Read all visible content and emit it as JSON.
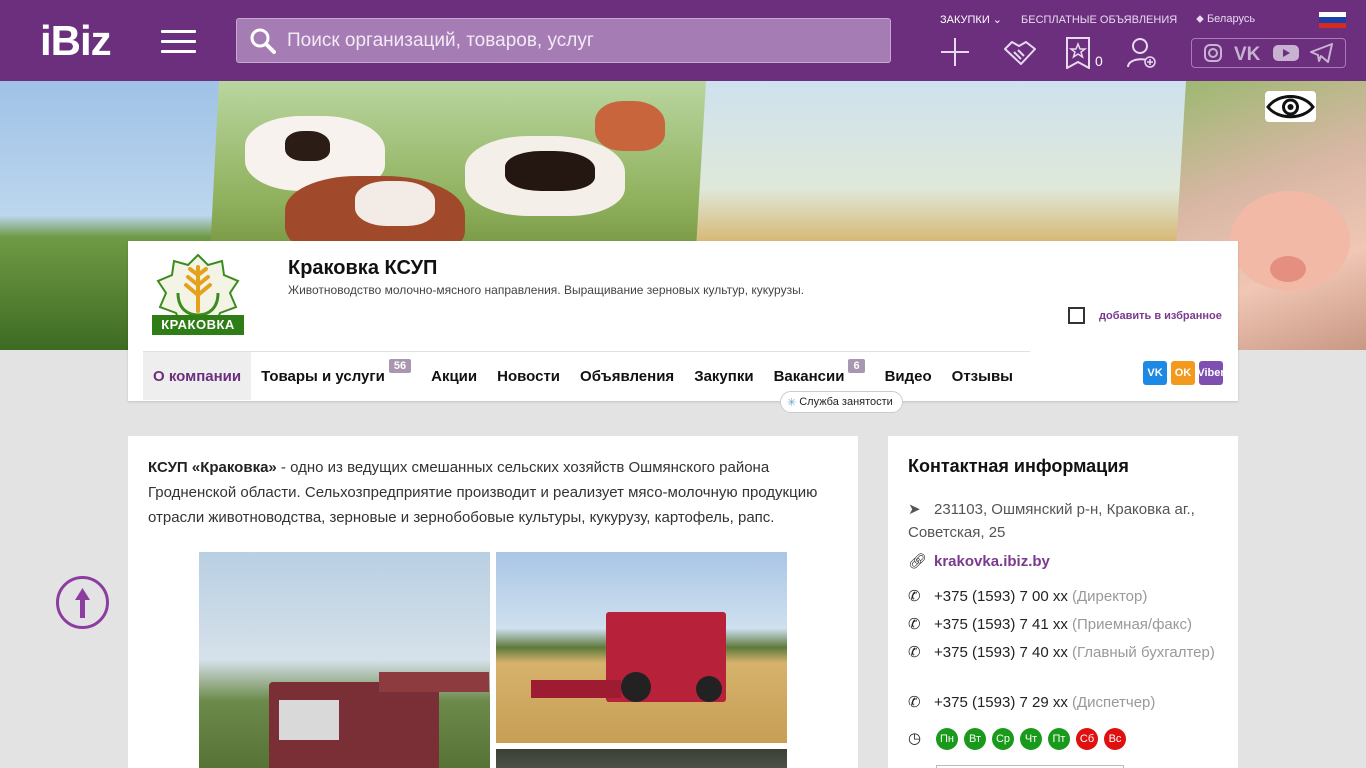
{
  "header": {
    "logo": "iBiz",
    "search_placeholder": "Поиск организаций, товаров, услуг",
    "links": [
      "ЗАКУПКИ",
      "БЕСПЛАТНЫЕ ОБЪЯВЛЕНИЯ",
      "Беларусь"
    ],
    "favorites_count": "0",
    "colors": {
      "brand": "#6b2f7e",
      "search_bg": "#a57cb3"
    },
    "icons": [
      "menu-icon",
      "search-icon",
      "plus-icon",
      "handshake-icon",
      "star-icon",
      "add-user-icon",
      "instagram-icon",
      "vk-icon",
      "youtube-icon",
      "telegram-icon",
      "location-icon"
    ]
  },
  "company": {
    "logo_text": "КРАКОВКА",
    "name": "Краковка КСУП",
    "description": "Животноводство молочно-мясного направления. Выращивание зерновых культур, кукурузы.",
    "favorite_label": "добавить в избранное",
    "tabs": [
      {
        "label": "О компании",
        "badge": ""
      },
      {
        "label": "Товары и услуги",
        "badge": "56"
      },
      {
        "label": "Акции",
        "badge": ""
      },
      {
        "label": "Новости",
        "badge": ""
      },
      {
        "label": "Объявления",
        "badge": ""
      },
      {
        "label": "Закупки",
        "badge": ""
      },
      {
        "label": "Вакансии",
        "badge": "6"
      },
      {
        "label": "Видео",
        "badge": ""
      },
      {
        "label": "Отзывы",
        "badge": ""
      }
    ],
    "vacancy_tag": "Служба занятости",
    "share": [
      "VK",
      "OK",
      "Viber"
    ]
  },
  "main": {
    "intro_bold": "КСУП «Краковка»",
    "intro_text": " - одно из ведущих смешанных сельских хозяйств Ошмянского района Гродненской области. Сельхозпредприятие производит и реализует мясо-молочную продукцию отрасли животноводства, зерновые и зернобобовые культуры, кукурузу, картофель, рапс."
  },
  "contacts": {
    "title": "Контактная информация",
    "address": "231103, Ошмянский р-н, Краковка аг., Советская, 25",
    "site": "krakovka.ibiz.by",
    "phones": [
      {
        "number": "+375 (1593) 7 00 xx",
        "note": "(Директор)"
      },
      {
        "number": "+375 (1593) 7 41 xx",
        "note": "(Приемная/факс)"
      },
      {
        "number": "+375 (1593) 7 40 xx",
        "note": "(Главный бухгалтер)"
      },
      {
        "number": "+375 (1593) 7 29 xx",
        "note": "(Диспетчер)"
      }
    ],
    "days": [
      {
        "label": "Пн",
        "color": "#1a9a1a"
      },
      {
        "label": "Вт",
        "color": "#1a9a1a"
      },
      {
        "label": "Ср",
        "color": "#1a9a1a"
      },
      {
        "label": "Чт",
        "color": "#1a9a1a"
      },
      {
        "label": "Пт",
        "color": "#1a9a1a"
      },
      {
        "label": "Сб",
        "color": "#e01010"
      },
      {
        "label": "Вс",
        "color": "#e01010"
      }
    ]
  }
}
